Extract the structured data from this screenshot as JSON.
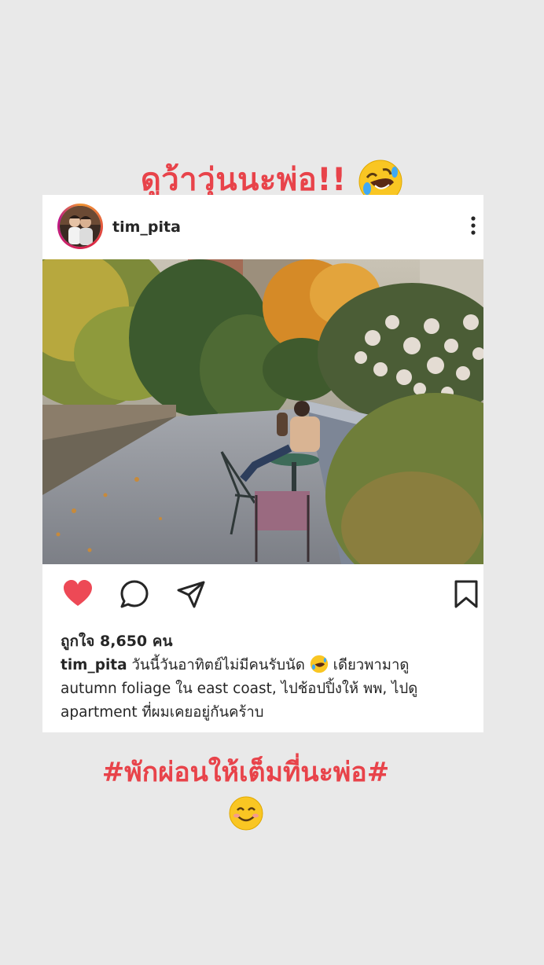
{
  "story": {
    "top_text": "ดูว้าวุ่นนะพ่อ!!",
    "top_emoji": "rolling-on-floor-laughing-emoji",
    "bottom_text": "#พักผ่อนให้เต็มที่นะพ่อ#",
    "bottom_emoji": "smiling-face-emoji"
  },
  "post": {
    "username": "tim_pita",
    "likes": "ถูกใจ 8,650 คน",
    "caption_user": "tim_pita",
    "caption_part1": "วันนี้วันอาทิตย์ไม่มีคนรับนัด",
    "caption_part2": "เดียวพามาดู autumn foliage ใน east coast, ไปช้อปปิ้งให้ พพ, ไปดู apartment ที่ผมเคยอยู่กันคร้าบ",
    "caption_emoji": "rolling-on-floor-laughing-emoji"
  },
  "colors": {
    "story_text": "#e8434a",
    "like_heart": "#ed4956",
    "background": "#e9e9e9"
  }
}
